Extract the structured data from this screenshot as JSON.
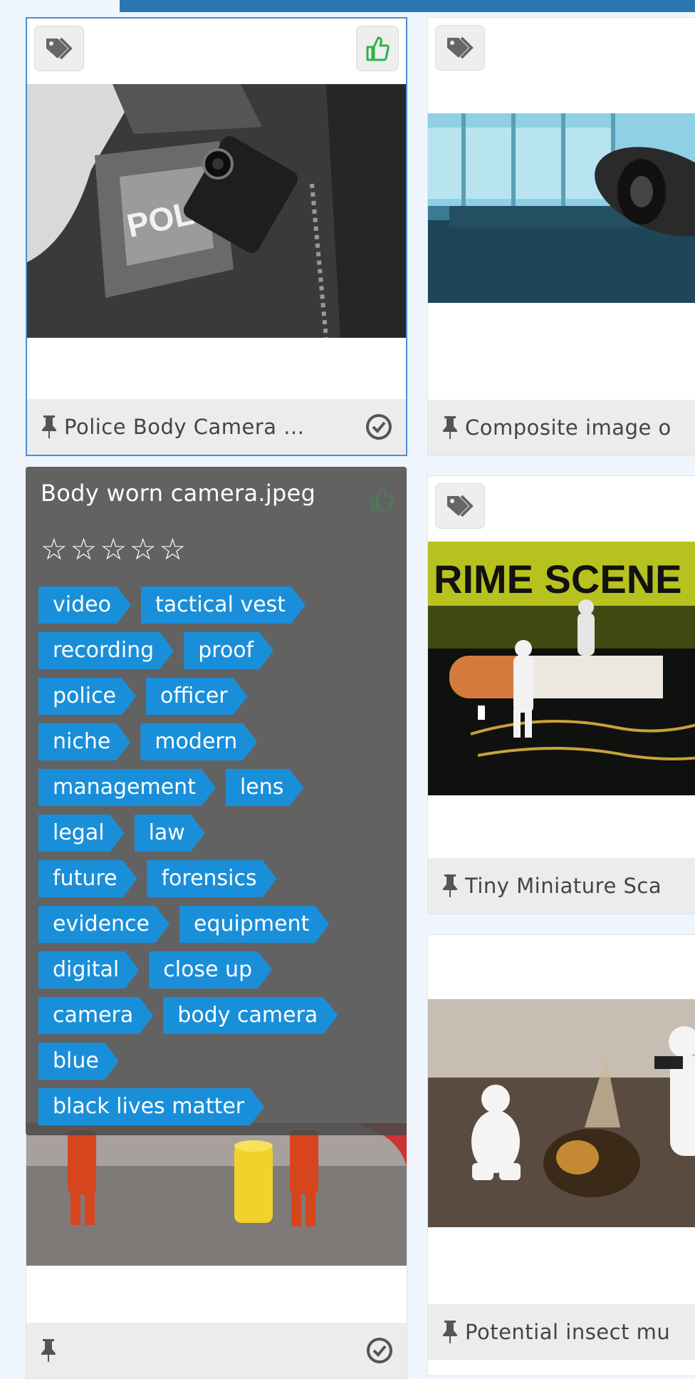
{
  "cards": [
    {
      "title": "Police Body Camera ...",
      "selected": true
    },
    {
      "title": "Composite image o"
    },
    {
      "title": "Tiny Miniature Sca"
    },
    {
      "title": "Potential insect mu"
    },
    {
      "title": ""
    }
  ],
  "hover_panel": {
    "filename": "Body worn camera.jpeg",
    "stars": [
      "☆",
      "☆",
      "☆",
      "☆",
      "☆"
    ],
    "tag_rows": [
      [
        "video",
        "tactical vest"
      ],
      [
        "recording",
        "proof"
      ],
      [
        "police",
        "officer"
      ],
      [
        "niche",
        "modern"
      ],
      [
        "management",
        "lens"
      ],
      [
        "legal",
        "law"
      ],
      [
        "future",
        "forensics"
      ],
      [
        "evidence",
        "equipment"
      ],
      [
        "digital",
        "close up"
      ],
      [
        "camera",
        "body camera"
      ],
      [
        "blue"
      ],
      [
        "black lives matter"
      ]
    ]
  },
  "colors": {
    "accent": "#2a76b0",
    "tag_bg": "#1a8fd9",
    "like_green": "#2db34a"
  },
  "icons": {
    "tag": "tag-icon",
    "like": "thumbs-up-icon",
    "pin": "pin-icon",
    "check": "check-circle-icon"
  }
}
